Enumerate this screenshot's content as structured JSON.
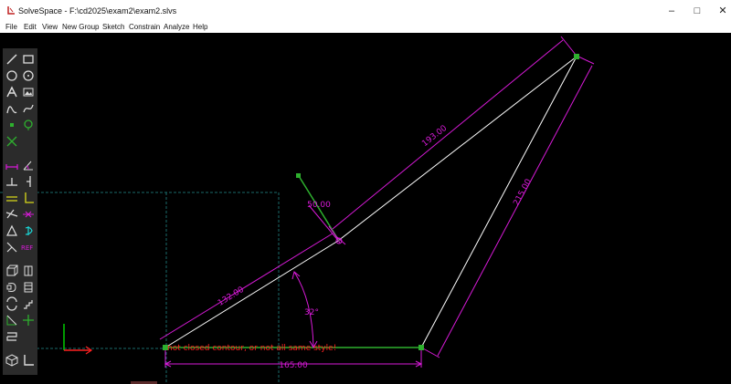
{
  "window": {
    "title": "SolveSpace - F:\\cd2025\\exam2\\exam2.slvs",
    "minimize": "–",
    "maximize": "□",
    "close": "✕"
  },
  "menu": [
    "File",
    "Edit",
    "View",
    "New Group",
    "Sketch",
    "Constrain",
    "Analyze",
    "Help"
  ],
  "toolbar": {
    "icons": [
      "line-icon",
      "rectangle-icon",
      "circle-icon",
      "arc-icon",
      "text-icon",
      "image-icon",
      "bezier-icon",
      "spline-icon",
      "point-icon",
      "construction-icon",
      "split-curves-icon",
      "distance-constraint-icon",
      "angle-constraint-icon",
      "horizontal-constraint-icon",
      "vertical-constraint-icon",
      "parallel-constraint-icon",
      "perpendicular-constraint-icon",
      "tangent-icon",
      "on-point-icon",
      "equal-icon",
      "symmetric-icon",
      "midpoint-icon",
      "reference-icon",
      "extrude-icon",
      "lathe-icon",
      "revolve-icon",
      "helix-icon",
      "step-translate-icon",
      "step-rotate-icon",
      "workplane-icon",
      "group-icon",
      "assembly-icon",
      "nearest-view-icon",
      "show-workplane-icon"
    ],
    "ref_label": "REF"
  },
  "sketch": {
    "dimensions": {
      "top_side": "193.00",
      "right_side": "215.00",
      "bottom_side": "165.00",
      "lower_left_segment": "132.00",
      "short_segment": "50.00",
      "angle": "32°"
    },
    "error_message": "not closed contour, or not all same style!"
  },
  "colors": {
    "geometry": "#ffffff",
    "dimension": "#d81ad8",
    "point": "#2eb02e",
    "error": "#ff2020",
    "axis_green": "#00cc00",
    "axis_red": "#ff2020",
    "workplane": "#1a6a6a"
  }
}
